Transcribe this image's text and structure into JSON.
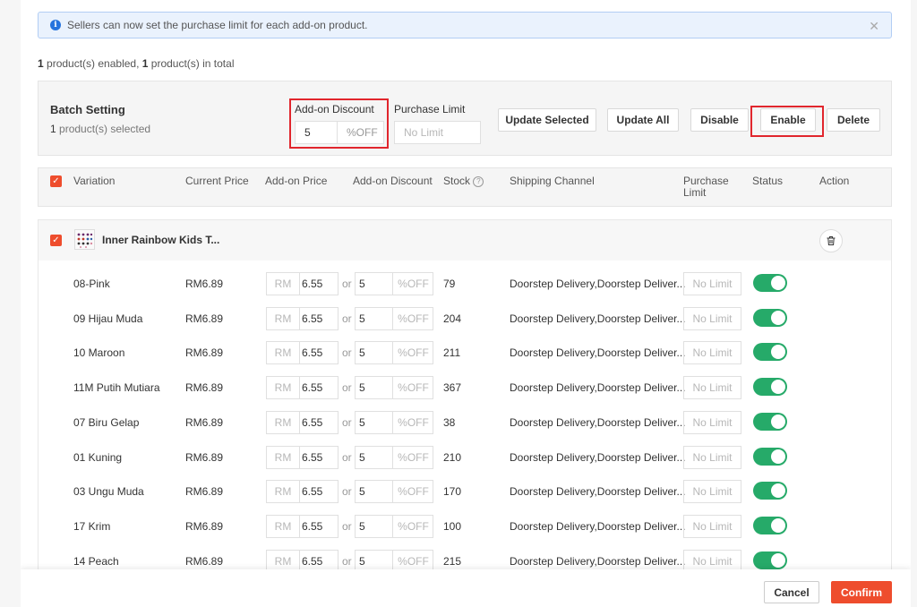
{
  "banner": {
    "message": "Sellers can now set the purchase limit for each add-on product."
  },
  "summary": {
    "enabled_count": "1",
    "enabled_text": " product(s) enabled, ",
    "total_count": "1",
    "total_text": " product(s) in total"
  },
  "batch": {
    "title": "Batch Setting",
    "selected_count": "1",
    "selected_text": " product(s) selected",
    "discount_label": "Add-on Discount",
    "discount_value": "5",
    "discount_suffix": "%OFF",
    "limit_label": "Purchase Limit",
    "limit_placeholder": "No Limit",
    "buttons": {
      "update_selected": "Update Selected",
      "update_all": "Update All",
      "disable": "Disable",
      "enable": "Enable",
      "delete": "Delete"
    }
  },
  "table": {
    "headers": {
      "variation": "Variation",
      "current_price": "Current Price",
      "addon_price": "Add-on Price",
      "addon_discount": "Add-on Discount",
      "stock": "Stock",
      "shipping": "Shipping Channel",
      "limit": "Purchase Limit",
      "status": "Status",
      "action": "Action"
    }
  },
  "product": {
    "name": "Inner Rainbow Kids T...",
    "variations": [
      {
        "name": "08-Pink",
        "current_price": "RM6.89",
        "currency": "RM",
        "addon_price": "6.55",
        "or": "or",
        "discount": "5",
        "discount_suffix": "%OFF",
        "stock": "79",
        "shipping": "Doorstep Delivery,Doorstep Deliver...",
        "limit": "No Limit",
        "enabled": true
      },
      {
        "name": "09 Hijau Muda",
        "current_price": "RM6.89",
        "currency": "RM",
        "addon_price": "6.55",
        "or": "or",
        "discount": "5",
        "discount_suffix": "%OFF",
        "stock": "204",
        "shipping": "Doorstep Delivery,Doorstep Deliver...",
        "limit": "No Limit",
        "enabled": true
      },
      {
        "name": "10 Maroon",
        "current_price": "RM6.89",
        "currency": "RM",
        "addon_price": "6.55",
        "or": "or",
        "discount": "5",
        "discount_suffix": "%OFF",
        "stock": "211",
        "shipping": "Doorstep Delivery,Doorstep Deliver...",
        "limit": "No Limit",
        "enabled": true
      },
      {
        "name": "11M Putih Mutiara",
        "current_price": "RM6.89",
        "currency": "RM",
        "addon_price": "6.55",
        "or": "or",
        "discount": "5",
        "discount_suffix": "%OFF",
        "stock": "367",
        "shipping": "Doorstep Delivery,Doorstep Deliver...",
        "limit": "No Limit",
        "enabled": true
      },
      {
        "name": "07 Biru Gelap",
        "current_price": "RM6.89",
        "currency": "RM",
        "addon_price": "6.55",
        "or": "or",
        "discount": "5",
        "discount_suffix": "%OFF",
        "stock": "38",
        "shipping": "Doorstep Delivery,Doorstep Deliver...",
        "limit": "No Limit",
        "enabled": true
      },
      {
        "name": "01 Kuning",
        "current_price": "RM6.89",
        "currency": "RM",
        "addon_price": "6.55",
        "or": "or",
        "discount": "5",
        "discount_suffix": "%OFF",
        "stock": "210",
        "shipping": "Doorstep Delivery,Doorstep Deliver...",
        "limit": "No Limit",
        "enabled": true
      },
      {
        "name": "03 Ungu Muda",
        "current_price": "RM6.89",
        "currency": "RM",
        "addon_price": "6.55",
        "or": "or",
        "discount": "5",
        "discount_suffix": "%OFF",
        "stock": "170",
        "shipping": "Doorstep Delivery,Doorstep Deliver...",
        "limit": "No Limit",
        "enabled": true
      },
      {
        "name": "17 Krim",
        "current_price": "RM6.89",
        "currency": "RM",
        "addon_price": "6.55",
        "or": "or",
        "discount": "5",
        "discount_suffix": "%OFF",
        "stock": "100",
        "shipping": "Doorstep Delivery,Doorstep Deliver...",
        "limit": "No Limit",
        "enabled": true
      },
      {
        "name": "14 Peach",
        "current_price": "RM6.89",
        "currency": "RM",
        "addon_price": "6.55",
        "or": "or",
        "discount": "5",
        "discount_suffix": "%OFF",
        "stock": "215",
        "shipping": "Doorstep Delivery,Doorstep Deliver...",
        "limit": "No Limit",
        "enabled": true
      }
    ]
  },
  "footer": {
    "cancel": "Cancel",
    "confirm": "Confirm"
  },
  "colors": {
    "brand": "#ee4d2d",
    "toggle_on": "#26aa69",
    "highlight": "#e1262d",
    "info": "#2673dd"
  },
  "icons": {
    "banner": "info-icon",
    "close": "close-icon",
    "stock_help": "question-icon",
    "delete": "trash-icon",
    "check": "check-icon"
  }
}
